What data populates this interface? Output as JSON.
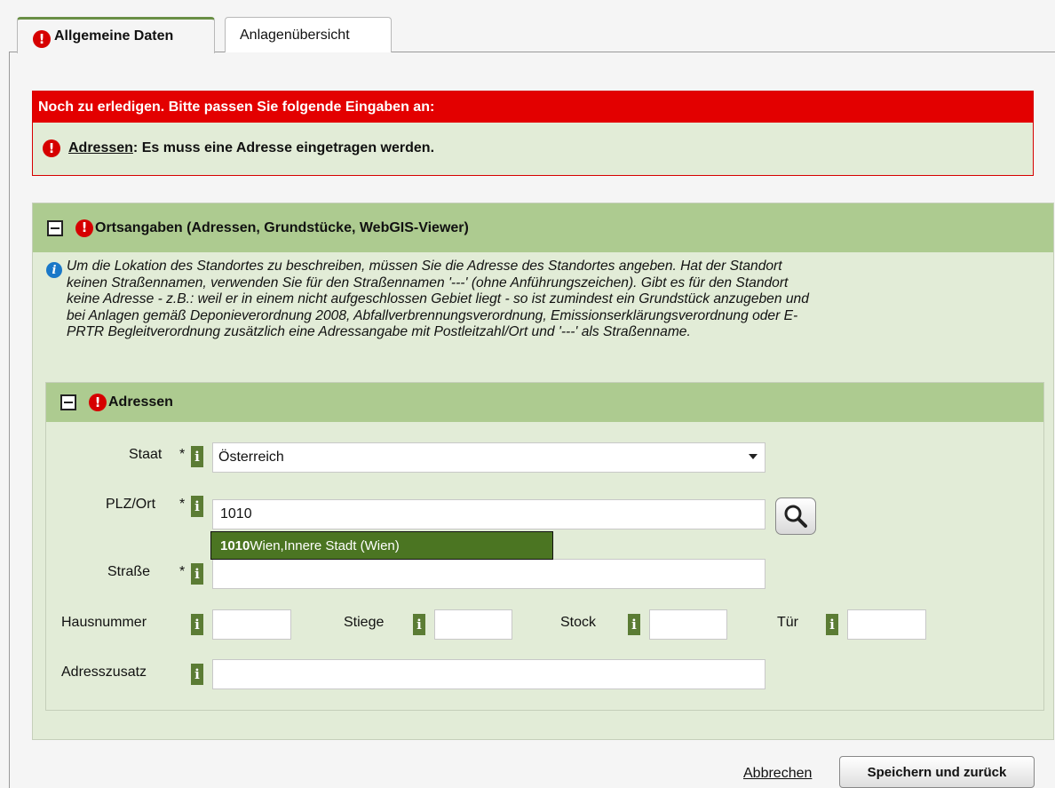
{
  "tabs": [
    {
      "label": "Allgemeine Daten",
      "error_icon": "!"
    },
    {
      "label": "Anlagenübersicht"
    }
  ],
  "errors": {
    "header": "Noch zu erledigen. Bitte passen Sie folgende Eingaben an:",
    "items": [
      {
        "link": "Adressen",
        "message": ": Es muss eine Adresse eingetragen werden."
      }
    ]
  },
  "location_section": {
    "title": "Ortsangaben (Adressen, Grundstücke, WebGIS-Viewer)",
    "info_lines": [
      "Um die Lokation des Standortes zu beschreiben, müssen Sie die Adresse des Standortes angeben. Hat der Standort",
      "keinen Straßennamen, verwenden Sie für den Straßennamen '---' (ohne Anführungszeichen). Gibt es für den Standort",
      "keine Adresse - z.B.: weil er in einem nicht aufgeschlossen Gebiet liegt - so ist zumindest ein Grundstück anzugeben und",
      "bei Anlagen gemäß Deponieverordnung 2008, Abfallverbrennungsverordnung, Emissionserklärungsverordnung oder E-",
      "PRTR Begleitverordnung zusätzlich eine Adressangabe mit Postleitzahl/Ort und '---' als Straßenname."
    ]
  },
  "address_section": {
    "title": "Adressen",
    "fields": {
      "staat": {
        "label": "Staat",
        "required": "*",
        "value": "Österreich"
      },
      "plz": {
        "label": "PLZ/Ort",
        "required": "*",
        "value": "1010"
      },
      "strasse": {
        "label": "Straße",
        "required": "*",
        "value": ""
      },
      "hausnummer": {
        "label": "Hausnummer",
        "value": ""
      },
      "stiege": {
        "label": "Stiege",
        "value": ""
      },
      "stock": {
        "label": "Stock",
        "value": ""
      },
      "tuer": {
        "label": "Tür",
        "value": ""
      },
      "adresszusatz": {
        "label": "Adresszusatz",
        "value": ""
      }
    },
    "info_glyph": "i",
    "autocomplete": {
      "match": "1010",
      "rest": " Wien,Innere Stadt (Wien)"
    }
  },
  "footer": {
    "cancel": "Abbrechen",
    "save": "Speichern und zurück"
  },
  "colors": {
    "error_red": "#e30000",
    "panel_green": "#e2ecd7",
    "header_green": "#adcb90",
    "info_green": "#5b7c34",
    "autocomplete_green": "#4b7522"
  }
}
